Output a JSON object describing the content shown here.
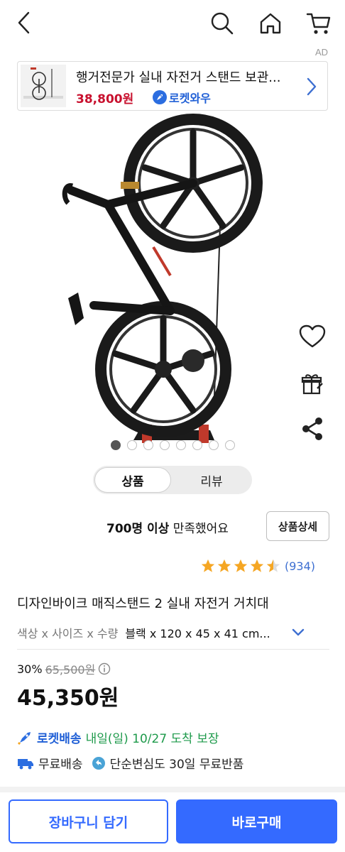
{
  "ad": {
    "label": "AD",
    "title": "행거전문가 실내 자전거 스탠드 보관...",
    "price": "38,800원",
    "badge": "로켓와우"
  },
  "tabs": [
    {
      "label": "상품",
      "active": true
    },
    {
      "label": "리뷰",
      "active": false
    }
  ],
  "gallery": {
    "dot_count": 8,
    "active_index": 0
  },
  "satisfaction": {
    "count": "700명 이상",
    "text": " 만족했어요"
  },
  "detail_button": "상품상세",
  "rating": {
    "stars": 4.5,
    "count": "(934)"
  },
  "product": {
    "title": "디자인바이크 매직스탠드 2 실내 자전거 거치대",
    "option_label": "색상 x 사이즈 x 수량",
    "option_value": "블랙 x 120 x 45 x 41 cm...",
    "discount": "30%",
    "original_price": "65,500원",
    "price": "45,350원"
  },
  "delivery": {
    "rocket": "로켓배송",
    "arrival": "내일(일) 10/27 도착 보장",
    "free_shipping": "무료배송",
    "free_return": "단순변심도 30일 무료반품"
  },
  "actions": {
    "cart": "장바구니 담기",
    "buy": "바로구매"
  },
  "colors": {
    "accent": "#346aff",
    "price_red": "#c8102e",
    "star": "#f5a623",
    "arrival_green": "#1e9a4b"
  }
}
